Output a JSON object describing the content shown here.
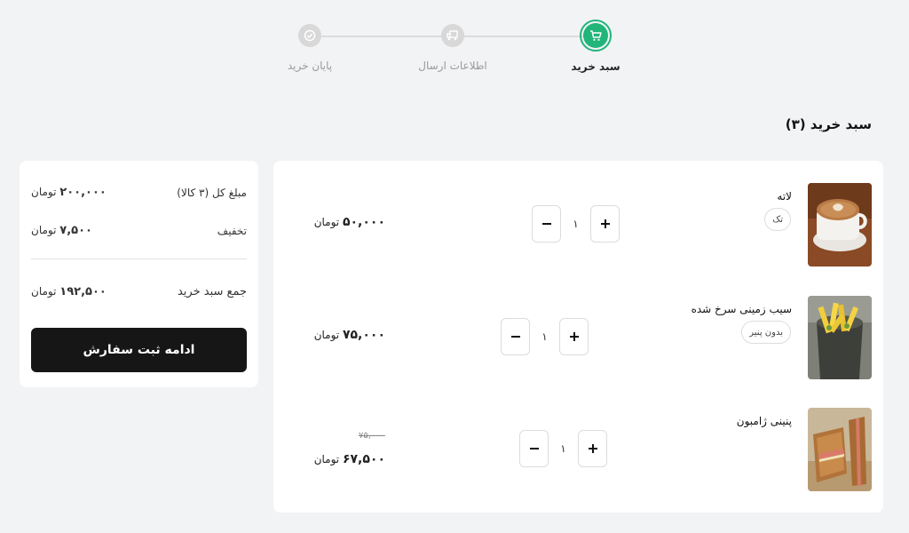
{
  "stepper": {
    "steps": [
      {
        "label": "سبد خرید",
        "state": "active"
      },
      {
        "label": "اطلاعات ارسال",
        "state": "inactive"
      },
      {
        "label": "پایان خرید",
        "state": "inactive"
      }
    ]
  },
  "cart": {
    "title": "سبد خرید (۳)"
  },
  "summary": {
    "total_label": "مبلغ کل (۳ کالا)",
    "total_value": "۲۰۰,۰۰۰",
    "total_unit": "تومان",
    "discount_label": "تخفیف",
    "discount_value": "۷,۵۰۰",
    "discount_unit": "تومان",
    "sum_label": "جمع سبد خرید",
    "sum_value": "۱۹۲,۵۰۰",
    "sum_unit": "تومان",
    "checkout_label": "ادامه ثبت سفارش"
  },
  "items": [
    {
      "name": "لاته",
      "option": "تک",
      "quantity": "۱",
      "price": "۵۰,۰۰۰",
      "unit": "تومان",
      "image": "latte-photo"
    },
    {
      "name": "سیب زمینی سرخ شده",
      "option": "بدون پنیر",
      "quantity": "۱",
      "price": "۷۵,۰۰۰",
      "unit": "تومان",
      "image": "fries-photo"
    },
    {
      "name": "پنینی ژامبون",
      "quantity": "۱",
      "old_price": "۷۵,۰۰۰",
      "price": "۶۷,۵۰۰",
      "unit": "تومان",
      "image": "panini-photo"
    }
  ],
  "icons": {
    "step1": "cart-icon",
    "step2": "delivery-truck-icon",
    "step3": "check-badge-icon",
    "plus": "plus-icon",
    "minus": "minus-icon"
  },
  "colors": {
    "accent": "#21b57a",
    "button_dark": "#161616",
    "page_bg": "#f2f3f5"
  }
}
